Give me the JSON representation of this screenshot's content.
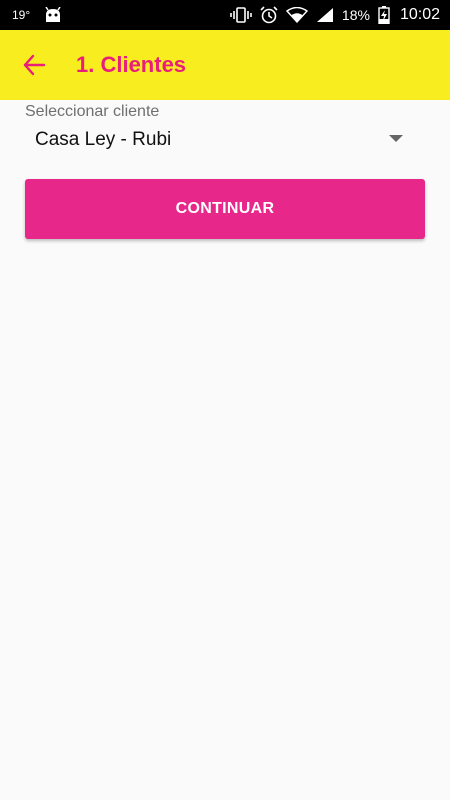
{
  "status_bar": {
    "temperature": "19°",
    "notification_icon": "android-icon",
    "icons": [
      "vibrate-icon",
      "alarm-icon",
      "wifi-icon",
      "signal-icon"
    ],
    "battery_percent": "18%",
    "battery_icon": "battery-charging-icon",
    "time": "10:02"
  },
  "app_bar": {
    "title": "1. Clientes",
    "back_icon": "arrow-left-icon",
    "background_color": "#f8ee1f",
    "title_color": "#e91e7a"
  },
  "form": {
    "select_label": "Seleccionar cliente",
    "select_value": "Casa Ley - Rubi",
    "continue_label": "CONTINUAR",
    "button_color": "#e8278a"
  }
}
